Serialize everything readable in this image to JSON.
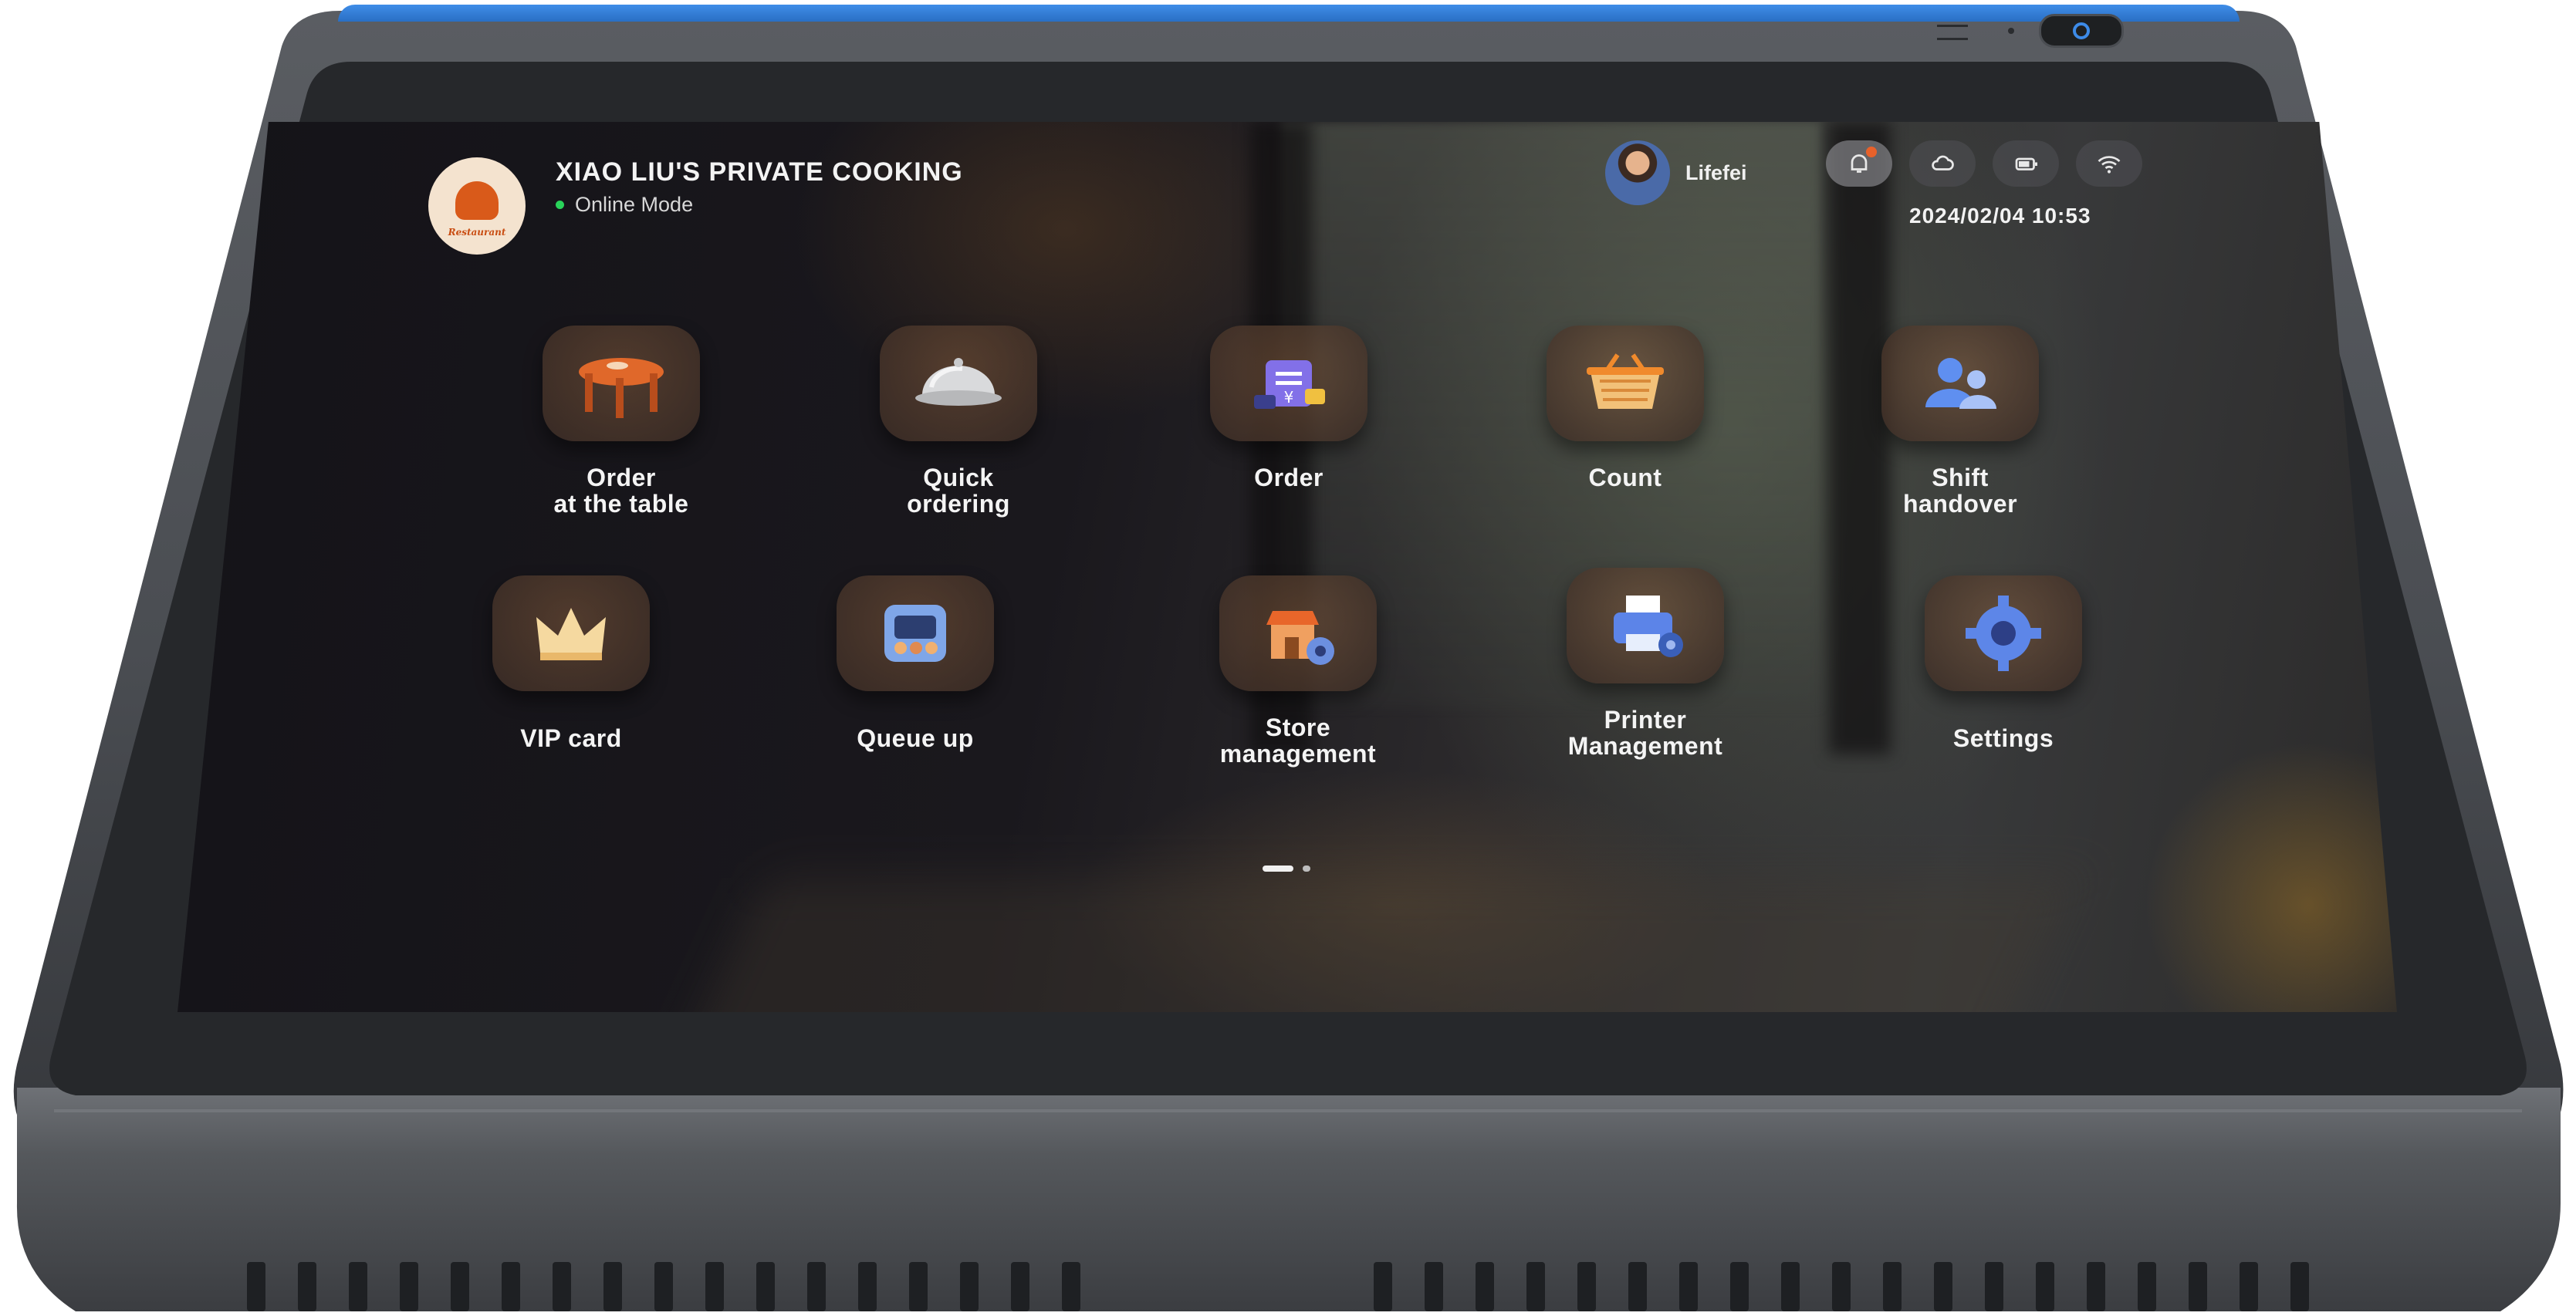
{
  "header": {
    "logo_text": "Restaurant",
    "shop_name": "XIAO LIU'S PRIVATE COOKING",
    "mode": "Online Mode",
    "mode_color": "#29d35a",
    "user_name": "Lifefei",
    "datetime": "2024/02/04  10:53",
    "status_icons": [
      "bell-icon",
      "cloud-icon",
      "battery-icon",
      "wifi-icon"
    ]
  },
  "apps": [
    {
      "label": "Order\nat the table",
      "icon": "dining-table-icon"
    },
    {
      "label": "Quick\nordering",
      "icon": "food-cloche-icon"
    },
    {
      "label": "Order",
      "icon": "receipt-icon"
    },
    {
      "label": "Count",
      "icon": "shopping-basket-icon"
    },
    {
      "label": "Shift\nhandover",
      "icon": "users-icon"
    },
    {
      "label": "VIP  card",
      "icon": "crown-icon"
    },
    {
      "label": "Queue up",
      "icon": "queue-icon"
    },
    {
      "label": "Store\nmanagement",
      "icon": "store-gear-icon"
    },
    {
      "label": "Printer\nManagement",
      "icon": "printer-gear-icon"
    },
    {
      "label": "Settings",
      "icon": "gear-icon"
    }
  ],
  "pager": {
    "pages": 2,
    "current": 1
  },
  "colors": {
    "accent_blue": "#3d8be8",
    "bezel": "#27292c",
    "frame": "#4b4e53"
  }
}
